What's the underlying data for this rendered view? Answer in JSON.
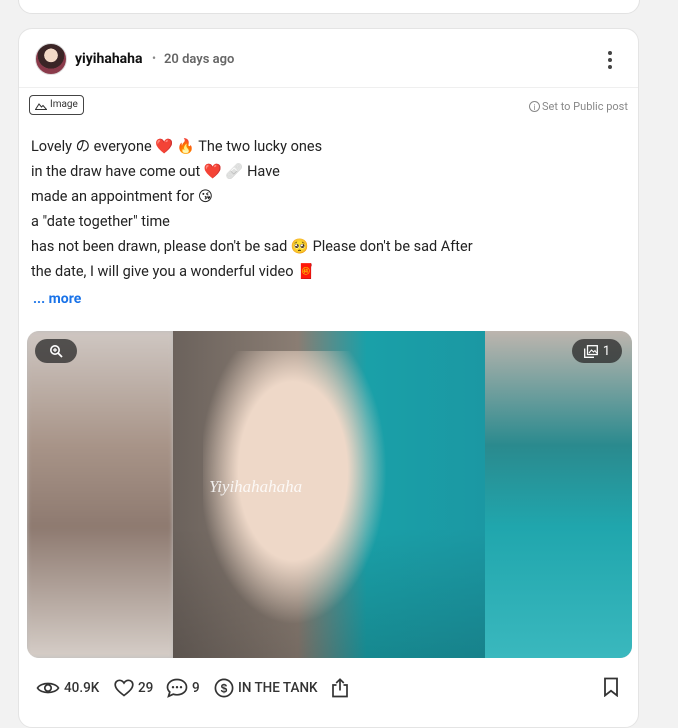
{
  "post": {
    "username": "yiyihahaha",
    "separator": "•",
    "time_ago": "20 days ago",
    "badge_label": "Image",
    "set_public_label": "Set to Public post",
    "text_lines": [
      "Lovely の everyone ❤️ 🔥 The two lucky ones",
      "in the draw have come out ❤️ 🩹 Have",
      "made an appointment for 😘",
      "a \"date together\" time",
      "has not been drawn, please don't be sad 🥺 Please don't be sad After",
      "the date, I will give you a wonderful video 🧧"
    ],
    "more_label": "... more"
  },
  "media": {
    "watermark": "Yiyihahahaha",
    "image_count": "1"
  },
  "footer": {
    "views": "40.9K",
    "likes": "29",
    "comments": "9",
    "tip_label": "IN THE TANK"
  },
  "icons": {
    "zoom": "magnifier-zoom-icon",
    "gallery": "gallery-icon",
    "eye": "eye-icon",
    "heart": "heart-icon",
    "comment": "comment-icon",
    "dollar": "dollar-circle-icon",
    "share": "share-icon",
    "bookmark": "bookmark-icon",
    "more": "more-vertical-icon",
    "info": "info-icon",
    "image_badge": "image-mountain-icon"
  },
  "colors": {
    "link_blue": "#1a73e8",
    "card_bg": "#ffffff",
    "page_bg": "#f2f2f2"
  }
}
